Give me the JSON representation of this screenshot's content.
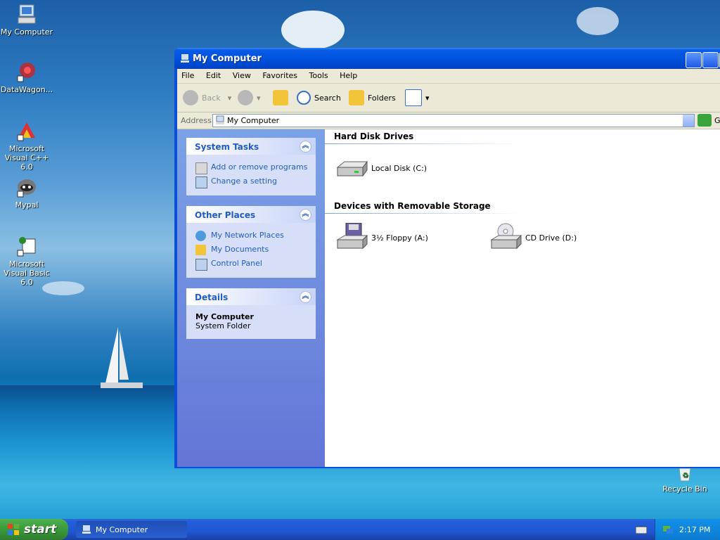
{
  "desktop": {
    "icons": [
      {
        "label": "My Computer"
      },
      {
        "label": "DataWagon..."
      },
      {
        "label": "Microsoft Visual C++ 6.0"
      },
      {
        "label": "Mypal"
      },
      {
        "label": "Microsoft Visual Basic 6.0"
      },
      {
        "label": "Recycle Bin"
      }
    ]
  },
  "window": {
    "title": "My Computer",
    "menu": [
      "File",
      "Edit",
      "View",
      "Favorites",
      "Tools",
      "Help"
    ],
    "toolbar": {
      "back": "Back",
      "search": "Search",
      "folders": "Folders"
    },
    "address": {
      "label": "Address",
      "value": "My Computer",
      "go": "Go"
    },
    "tasks": {
      "system": {
        "title": "System Tasks",
        "items": [
          "Add or remove programs",
          "Change a setting"
        ]
      },
      "places": {
        "title": "Other Places",
        "items": [
          "My Network Places",
          "My Documents",
          "Control Panel"
        ]
      },
      "details": {
        "title": "Details",
        "name": "My Computer",
        "type": "System Folder"
      }
    },
    "groups": [
      {
        "title": "Hard Disk Drives",
        "items": [
          "Local Disk (C:)"
        ]
      },
      {
        "title": "Devices with Removable Storage",
        "items": [
          "3½ Floppy (A:)",
          "CD Drive (D:)"
        ]
      }
    ]
  },
  "taskbar": {
    "start": "start",
    "task": "My Computer",
    "clock": "2:17 PM"
  }
}
